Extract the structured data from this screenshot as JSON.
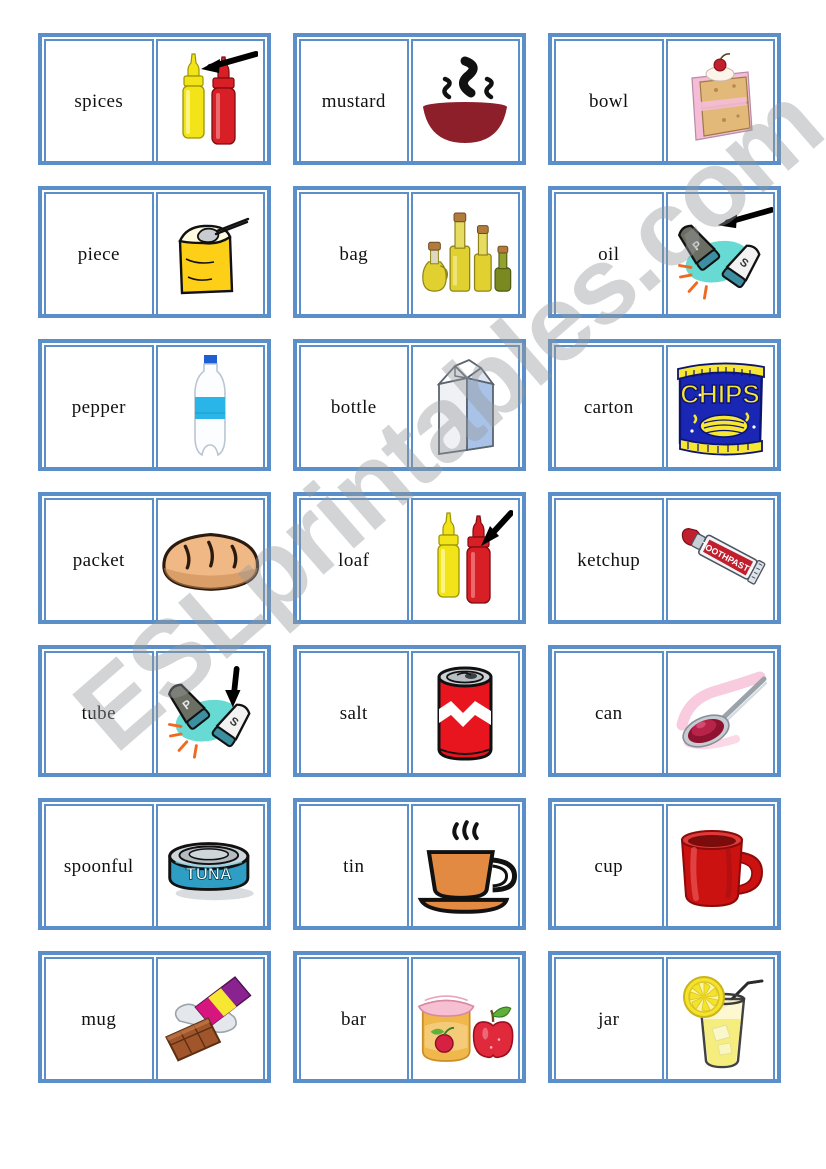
{
  "watermark": {
    "text": "ESLprintables.com"
  },
  "sheet": {
    "type": "vocabulary-domino-cards",
    "columns": 3,
    "rows": 7,
    "border_color": "#5b8fc9",
    "background": "#ffffff"
  },
  "cards": [
    {
      "word": "spices",
      "picture": "squeeze-bottles-mustard-ketchup-with-arrow-at-yellow",
      "arrow": "left-pointing"
    },
    {
      "word": "mustard",
      "picture": "steaming-dark-red-soup-bowl",
      "arrow": "none"
    },
    {
      "word": "bowl",
      "picture": "slice-of-cake-with-pink-frosting-and-cherry",
      "arrow": "none"
    },
    {
      "word": "piece",
      "picture": "yellow-flour-bag-with-spoon",
      "arrow": "none"
    },
    {
      "word": "bag",
      "picture": "olive-oil-bottles-group",
      "arrow": "none"
    },
    {
      "word": "oil",
      "picture": "salt-and-pepper-shakers-with-arrow-at-pepper",
      "arrow": "left-pointing"
    },
    {
      "word": "pepper",
      "picture": "plastic-water-bottle-with-blue-label",
      "arrow": "none"
    },
    {
      "word": "bottle",
      "picture": "milk-carton",
      "arrow": "none"
    },
    {
      "word": "carton",
      "picture": "blue-chips-bag",
      "arrow": "none"
    },
    {
      "word": "packet",
      "picture": "loaf-of-bread",
      "arrow": "none"
    },
    {
      "word": "loaf",
      "picture": "squeeze-bottles-mustard-ketchup-with-arrow-at-red",
      "arrow": "down-left-pointing"
    },
    {
      "word": "ketchup",
      "picture": "toothpaste-tube",
      "arrow": "none"
    },
    {
      "word": "tube",
      "picture": "salt-and-pepper-shakers-with-arrow-at-salt",
      "arrow": "down-pointing"
    },
    {
      "word": "salt",
      "picture": "red-soda-can",
      "arrow": "none"
    },
    {
      "word": "can",
      "picture": "spoon-with-red-liquid",
      "arrow": "none"
    },
    {
      "word": "spoonful",
      "picture": "tuna-tin",
      "arrow": "none"
    },
    {
      "word": "tin",
      "picture": "orange-coffee-cup-with-steam",
      "arrow": "none"
    },
    {
      "word": "cup",
      "picture": "red-mug",
      "arrow": "none"
    },
    {
      "word": "mug",
      "picture": "chocolate-bar-in-wrapper",
      "arrow": "none"
    },
    {
      "word": "bar",
      "picture": "jam-jar-with-apple",
      "arrow": "none"
    },
    {
      "word": "jar",
      "picture": "glass-of-lemonade-with-lemon-slice-and-straw",
      "arrow": "none"
    }
  ],
  "picture_labels": {
    "chips_bag_text": "CHIPS",
    "tuna_tin_text": "TUNA",
    "toothpaste_tube_text": "TOOTHPASTE",
    "pepper_shaker_letter": "P",
    "salt_shaker_letter": "S"
  },
  "colors": {
    "card_border": "#5b8fc9",
    "mustard_yellow": "#f2e418",
    "ketchup_red": "#d81f26",
    "bowl_dark_red": "#8c1f2a",
    "cake_tan": "#e3b97a",
    "cake_frosting_pink": "#f5bcd6",
    "flour_bag_yellow": "#fdd017",
    "olive_oil_yellow": "#e0d030",
    "water_blue": "#29b5e8",
    "chips_blue": "#1a27b5",
    "chips_yellow": "#f7e733",
    "bread_tan": "#f0b884",
    "soda_red": "#e8151e",
    "tuna_blue": "#2e9ec4",
    "coffee_orange": "#e28a42",
    "mug_red": "#cc1111",
    "jam_orange": "#f0b84a",
    "apple_red": "#e02a3c",
    "lemon_yellow": "#f5e32a",
    "watermark_gray": "#96989c"
  }
}
